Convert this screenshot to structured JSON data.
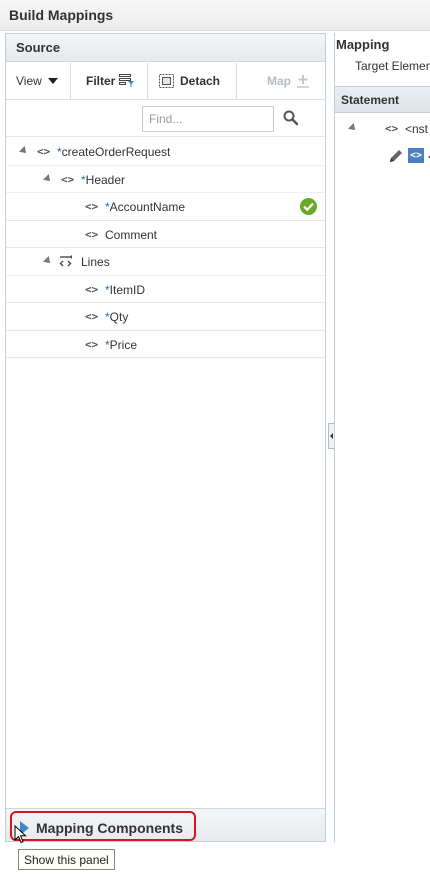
{
  "window": {
    "title": "Build Mappings"
  },
  "source": {
    "title": "Source",
    "toolbar": {
      "view_label": "View",
      "filter_label": "Filter",
      "detach_label": "Detach",
      "map_label": "Map"
    },
    "search": {
      "placeholder": "Find..."
    },
    "tree": [
      {
        "label": "createOrderRequest",
        "required": true,
        "level": 0,
        "expanded": true,
        "icon": "element-icon"
      },
      {
        "label": "Header",
        "required": true,
        "level": 1,
        "expanded": true,
        "icon": "element-icon"
      },
      {
        "label": "AccountName",
        "required": true,
        "level": 2,
        "mapped": true,
        "icon": "element-icon"
      },
      {
        "label": "Comment",
        "required": false,
        "level": 2,
        "icon": "element-icon"
      },
      {
        "label": "Lines",
        "required": false,
        "level": 1,
        "expanded": true,
        "icon": "repeating-element-icon"
      },
      {
        "label": "ItemID",
        "required": true,
        "level": 2,
        "icon": "element-icon"
      },
      {
        "label": "Qty",
        "required": true,
        "level": 2,
        "icon": "element-icon"
      },
      {
        "label": "Price",
        "required": true,
        "level": 2,
        "icon": "element-icon"
      }
    ],
    "footer": {
      "mapping_components_label": "Mapping Components"
    }
  },
  "tooltip": {
    "text": "Show this panel"
  },
  "mapping": {
    "title": "Mapping",
    "target_label": "Target Elemen",
    "statement_header": "Statement",
    "statement_rows": [
      "<nst",
      "<"
    ]
  },
  "colors": {
    "required_marker": "#1f6db5",
    "mapped_check": "#6aa828",
    "highlight_border": "#d8141e",
    "panel_border": "#c4ced7"
  }
}
